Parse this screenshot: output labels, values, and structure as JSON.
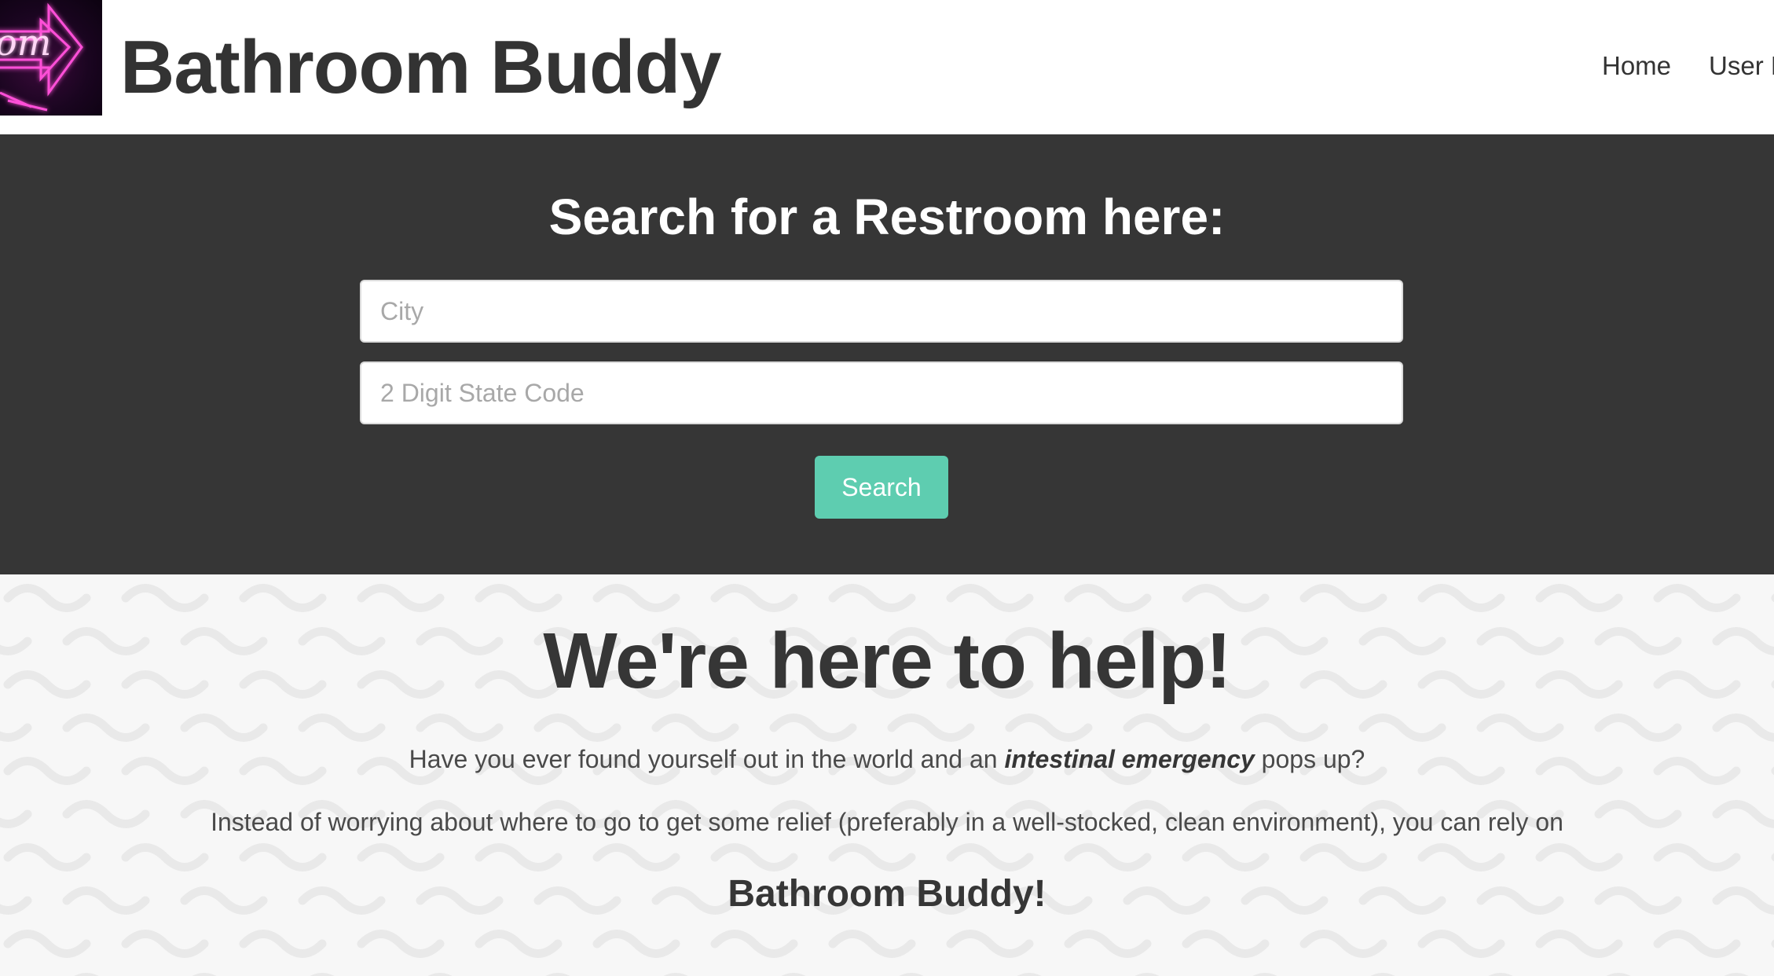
{
  "header": {
    "logo_text": "om",
    "title": "Bathroom Buddy",
    "nav": {
      "home": "Home",
      "user": "User P"
    }
  },
  "search": {
    "heading": "Search for a Restroom here:",
    "city_placeholder": "City",
    "city_value": "",
    "state_placeholder": "2 Digit State Code",
    "state_value": "",
    "button_label": "Search"
  },
  "help": {
    "heading": "We're here to help!",
    "p1_before": "Have you ever found yourself out in the world and an ",
    "p1_emphasis": "intestinal emergency",
    "p1_after": " pops up?",
    "p2": "Instead of worrying about where to go to get some relief (preferably in a well-stocked, clean environment), you can rely on",
    "brand": "Bathroom Buddy!"
  },
  "colors": {
    "header_bg": "#ffffff",
    "title_text": "#333333",
    "search_band_bg": "#363636",
    "search_button_bg": "#5ecdb0",
    "help_bg": "#f7f7f7",
    "logo_neon": "#ff3fd0"
  },
  "icons": {
    "logo": "neon-restroom-sign-icon"
  }
}
